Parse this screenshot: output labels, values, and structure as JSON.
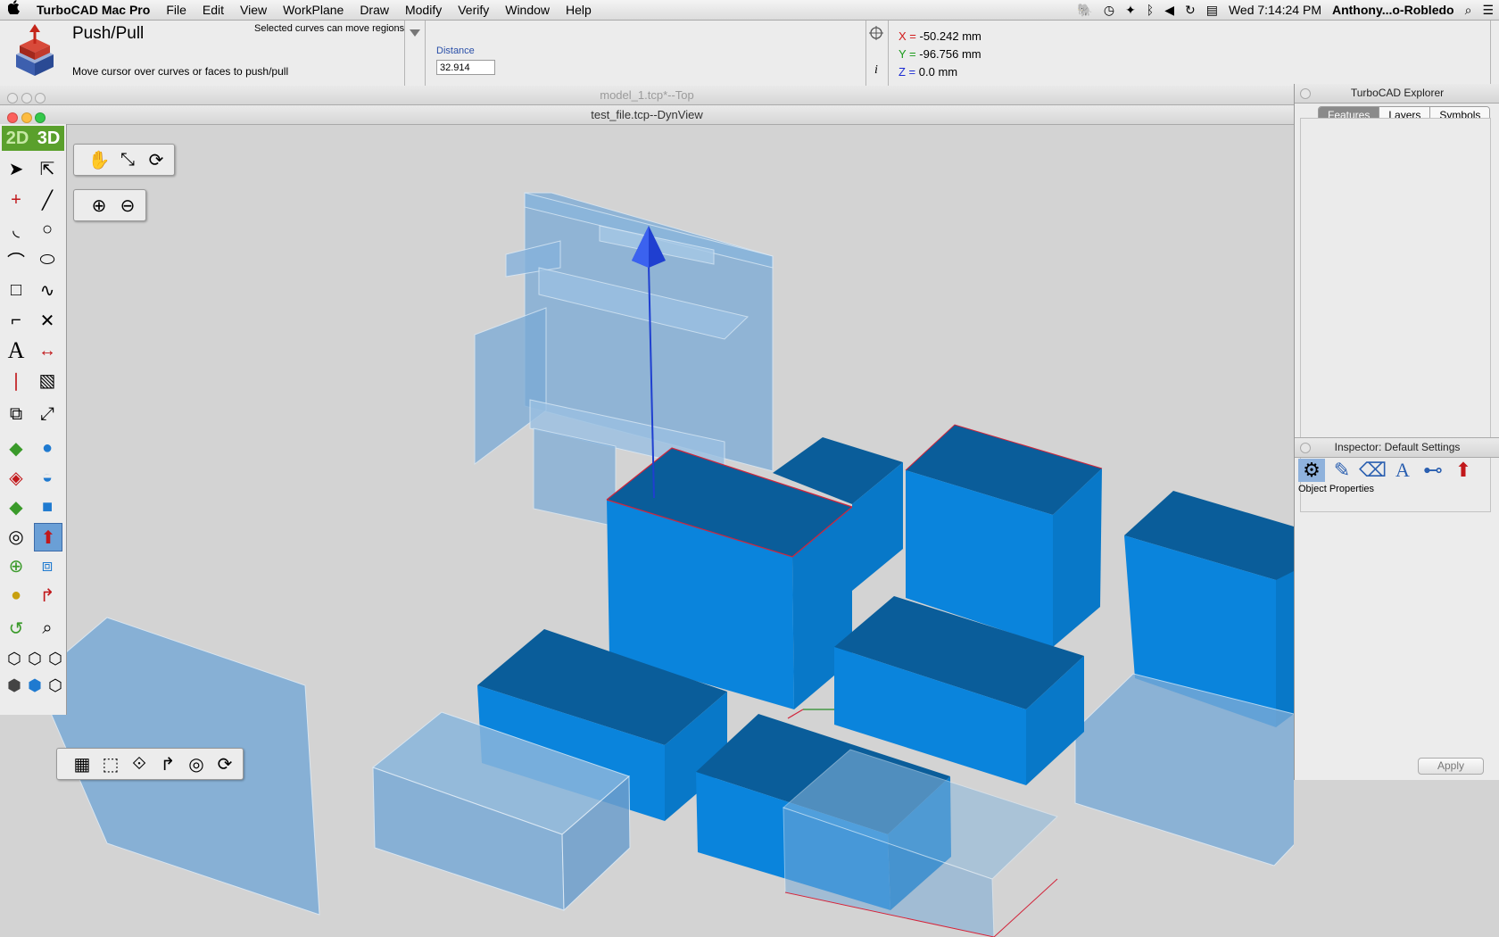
{
  "menubar": {
    "apple": "",
    "app_name": "TurboCAD Mac Pro",
    "menus": [
      "File",
      "Edit",
      "View",
      "WorkPlane",
      "Draw",
      "Modify",
      "Verify",
      "Window",
      "Help"
    ],
    "clock": "Wed 7:14:24 PM",
    "user": "Anthony...o-Robledo"
  },
  "tool": {
    "name": "Push/Pull",
    "hint": "Selected curves can move regions",
    "instruction": "Move cursor over curves or faces to push/pull",
    "distance_label": "Distance",
    "distance_value": "32.914"
  },
  "coords": {
    "x_axis": "X =",
    "x_value": "-50.242 mm",
    "y_axis": "Y =",
    "y_value": "-96.756 mm",
    "z_axis": "Z =",
    "z_value": "0.0 mm",
    "info_glyph": "i"
  },
  "windows": {
    "back_title": "model_1.tcp*--Top",
    "front_title": "test_file.tcp--DynView"
  },
  "palette": {
    "mode_2d": "2D",
    "mode_3d": "3D",
    "text_tool": "A"
  },
  "explorer": {
    "title": "TurboCAD Explorer",
    "tabs": [
      "Features",
      "Layers",
      "Symbols"
    ],
    "active_tab": "Features"
  },
  "inspector": {
    "title": "Inspector: Default Settings",
    "section": "Object Properties",
    "text_icon": "A",
    "apply_label": "Apply"
  },
  "colors": {
    "solid_top": "#0a5d9a",
    "solid_side": "#0a84dc",
    "ghost": "#7aaad6",
    "arrow": "#1f3fd0",
    "selection_edge": "#d2243a"
  }
}
